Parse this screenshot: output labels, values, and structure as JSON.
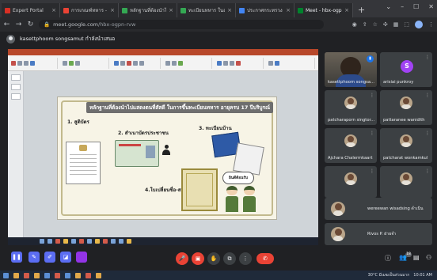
{
  "browser": {
    "tabs": [
      {
        "title": "Expert Portal",
        "color": "#d93025"
      },
      {
        "title": "การเกณฑ์ทหาร - บริ - Google",
        "color": "#ea4335"
      },
      {
        "title": "หลักฐานที่ต้องนำไปแสดง",
        "color": "#34a853"
      },
      {
        "title": "ทะเบียนทหาร ในสำนักงาน",
        "color": "#34a853"
      },
      {
        "title": "ประกาศกระทรวง (ชื่อแนบ)",
        "color": "#4285f4"
      },
      {
        "title": "Meet - hbx-ogpn-rv",
        "color": "#00832d"
      }
    ],
    "new_tab": "+",
    "url_scheme": "meet.google.com",
    "url_path": "/hbx-ogpn-rvw"
  },
  "meet": {
    "presenter_label": "kasettphoom songsamut กำลังนำเสนอ",
    "slide": {
      "title": "หลักฐานที่ต้องนำไปแสดงตนที่สัสดี ในการขึ้นทะเบียนทหาร อายุครบ 17 ปีบริบูรณ์",
      "item1": "1. สูติบัตร",
      "item2": "2. สำเนาบัตรประชาชน",
      "item3": "3. ทะเบียนบ้าน",
      "item4": "4.ใบเปลี่ยนชื่อ-สกุล",
      "bubble": "ยินดีต้อนรับ"
    },
    "participants": [
      {
        "name": "kasettphoom songsa...",
        "type": "video"
      },
      {
        "name": "arisiai punkroy",
        "type": "letter",
        "letter": "S",
        "color": "#a142f4"
      },
      {
        "name": "patcharaporn singtor...",
        "type": "photo"
      },
      {
        "name": "pattaranee wanidith",
        "type": "photo"
      },
      {
        "name": "Ajchara Chalermkaart",
        "type": "photo"
      },
      {
        "name": "patcharat wonkamkul",
        "type": "photo"
      },
      {
        "name": "",
        "type": "photo"
      },
      {
        "name": "",
        "type": "photo"
      }
    ],
    "strip": [
      {
        "name": "wereewan wisadsing ดำเนิน"
      },
      {
        "name": "Rivos P. ฝ่ายจำ"
      }
    ],
    "participant_count": "18",
    "colors": {
      "end_call": "#ea4335",
      "accent": "#1a73e8"
    }
  },
  "taskbar": {
    "weather": "30°C มีเมฆเป็นส่วนมาก",
    "clock": "10:01 AM"
  }
}
